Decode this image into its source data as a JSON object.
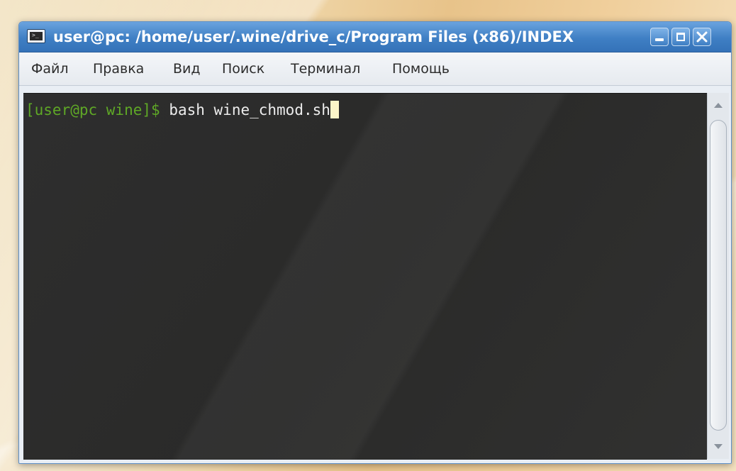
{
  "window": {
    "title": "user@pc: /home/user/.wine/drive_c/Program Files (x86)/INDEX"
  },
  "menu": {
    "items": [
      "Файл",
      "Правка",
      "Вид",
      "Поиск",
      "Терминал",
      "Помощь"
    ]
  },
  "terminal": {
    "prompt": "[user@pc wine]$",
    "command": "bash wine_chmod.sh"
  },
  "icons": {
    "app": "terminal-icon",
    "minimize": "minimize-icon",
    "maximize": "maximize-icon",
    "close": "close-icon"
  },
  "colors": {
    "titlebar": "#3f7fc4",
    "terminal_bg": "#2d2d2c",
    "prompt": "#5fa826",
    "command_text": "#ececec",
    "cursor": "#fbf5c8"
  }
}
